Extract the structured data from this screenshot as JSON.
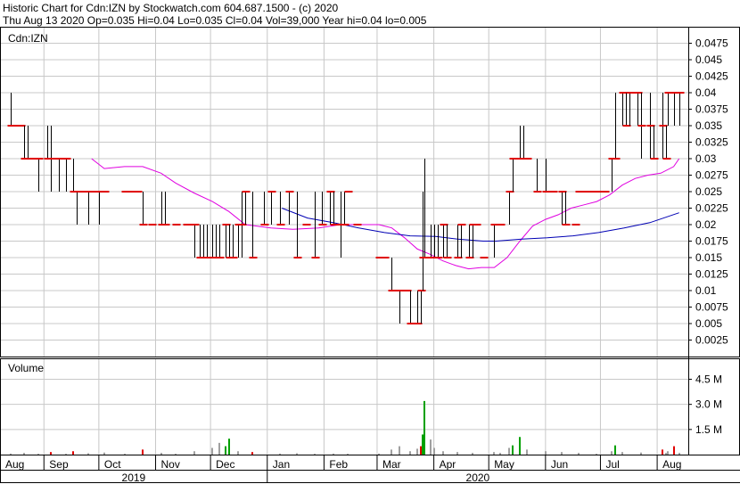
{
  "header": {
    "line1": "Historic Chart for Cdn:IZN by Stockwatch.com 604.687.1500 - (c) 2020",
    "line2": "Thu Aug 13 2020  Op=0.035  Hi=0.04  Lo=0.035  Cl=0.04  Vol=39,000  Year hi=0.04  lo=0.005"
  },
  "colors": {
    "background": "#ffffff",
    "grid": "#c8c8c8",
    "price_bar": "#000000",
    "close_tick": "#e00000",
    "ma_short": "#e000e0",
    "ma_long": "#0000b4",
    "vol_up": "#00a000",
    "vol_down": "#e00000",
    "vol_flat": "#a0a0a0"
  },
  "chart_data": [
    {
      "type": "ohlc",
      "title": "Cdn:IZN",
      "ylim": [
        0,
        0.05
      ],
      "y_ticks": [
        "0.0475",
        "0.045",
        "0.0425",
        "0.04",
        "0.0375",
        "0.035",
        "0.0325",
        "0.03",
        "0.0275",
        "0.025",
        "0.0225",
        "0.02",
        "0.0175",
        "0.015",
        "0.0125",
        "0.01",
        "0.0075",
        "0.005",
        "0.0025"
      ],
      "x_months": [
        "Aug",
        "Sep",
        "Oct",
        "Nov",
        "Dec",
        "Jan",
        "Feb",
        "Mar",
        "Apr",
        "May",
        "Jun",
        "Jul",
        "Aug"
      ],
      "x_years": [
        "2019",
        "2020"
      ],
      "grid": true,
      "bars": [
        [
          "2019-08-14",
          0.04,
          0.035,
          0.035
        ],
        [
          "2019-08-16",
          0.035,
          0.035,
          0.035
        ],
        [
          "2019-08-19",
          0.035,
          0.035,
          0.035
        ],
        [
          "2019-08-21",
          0.035,
          0.03,
          0.03
        ],
        [
          "2019-08-23",
          0.035,
          0.03,
          0.03
        ],
        [
          "2019-08-27",
          0.03,
          0.03,
          0.03
        ],
        [
          "2019-08-29",
          0.03,
          0.025,
          0.03
        ],
        [
          "2019-09-03",
          0.035,
          0.03,
          0.03
        ],
        [
          "2019-09-05",
          0.035,
          0.025,
          0.03
        ],
        [
          "2019-09-09",
          0.03,
          0.025,
          0.03
        ],
        [
          "2019-09-11",
          0.03,
          0.03,
          0.03
        ],
        [
          "2019-09-13",
          0.03,
          0.025,
          0.03
        ],
        [
          "2019-09-17",
          0.03,
          0.025,
          0.025
        ],
        [
          "2019-09-19",
          0.025,
          0.02,
          0.025
        ],
        [
          "2019-09-23",
          0.025,
          0.025,
          0.025
        ],
        [
          "2019-09-25",
          0.025,
          0.02,
          0.025
        ],
        [
          "2019-09-27",
          0.025,
          0.025,
          0.025
        ],
        [
          "2019-10-01",
          0.025,
          0.02,
          0.025
        ],
        [
          "2019-10-04",
          0.025,
          0.025,
          0.025
        ],
        [
          "2019-10-15",
          0.025,
          0.025,
          0.025
        ],
        [
          "2019-10-18",
          0.025,
          0.025,
          0.025
        ],
        [
          "2019-10-22",
          0.025,
          0.025,
          0.025
        ],
        [
          "2019-10-25",
          0.025,
          0.02,
          0.02
        ],
        [
          "2019-10-30",
          0.02,
          0.02,
          0.02
        ],
        [
          "2019-11-04",
          0.025,
          0.02,
          0.02
        ],
        [
          "2019-11-06",
          0.025,
          0.02,
          0.02
        ],
        [
          "2019-11-12",
          0.02,
          0.02,
          0.02
        ],
        [
          "2019-11-18",
          0.02,
          0.02,
          0.02
        ],
        [
          "2019-11-22",
          0.02,
          0.015,
          0.02
        ],
        [
          "2019-11-25",
          0.02,
          0.015,
          0.015
        ],
        [
          "2019-11-27",
          0.02,
          0.015,
          0.015
        ],
        [
          "2019-11-29",
          0.02,
          0.015,
          0.015
        ],
        [
          "2019-12-02",
          0.02,
          0.015,
          0.015
        ],
        [
          "2019-12-04",
          0.02,
          0.015,
          0.015
        ],
        [
          "2019-12-06",
          0.02,
          0.015,
          0.015
        ],
        [
          "2019-12-09",
          0.02,
          0.015,
          0.02
        ],
        [
          "2019-12-11",
          0.02,
          0.015,
          0.015
        ],
        [
          "2019-12-13",
          0.02,
          0.015,
          0.015
        ],
        [
          "2019-12-16",
          0.02,
          0.015,
          0.02
        ],
        [
          "2019-12-18",
          0.025,
          0.015,
          0.02
        ],
        [
          "2019-12-20",
          0.025,
          0.02,
          0.025
        ],
        [
          "2019-12-24",
          0.025,
          0.015,
          0.015
        ],
        [
          "2019-12-30",
          0.025,
          0.02,
          0.02
        ],
        [
          "2020-01-03",
          0.025,
          0.02,
          0.025
        ],
        [
          "2020-01-08",
          0.025,
          0.02,
          0.02
        ],
        [
          "2020-01-13",
          0.025,
          0.02,
          0.025
        ],
        [
          "2020-01-17",
          0.025,
          0.015,
          0.015
        ],
        [
          "2020-01-22",
          0.02,
          0.02,
          0.02
        ],
        [
          "2020-01-27",
          0.025,
          0.015,
          0.015
        ],
        [
          "2020-01-31",
          0.025,
          0.02,
          0.02
        ],
        [
          "2020-02-04",
          0.025,
          0.02,
          0.025
        ],
        [
          "2020-02-06",
          0.025,
          0.02,
          0.02
        ],
        [
          "2020-02-10",
          0.025,
          0.015,
          0.02
        ],
        [
          "2020-02-12",
          0.025,
          0.02,
          0.02
        ],
        [
          "2020-02-14",
          0.025,
          0.025,
          0.025
        ],
        [
          "2020-02-19",
          0.02,
          0.02,
          0.02
        ],
        [
          "2020-03-02",
          0.015,
          0.015,
          0.015
        ],
        [
          "2020-03-05",
          0.015,
          0.015,
          0.015
        ],
        [
          "2020-03-09",
          0.015,
          0.01,
          0.01
        ],
        [
          "2020-03-11",
          0.01,
          0.01,
          0.01
        ],
        [
          "2020-03-13",
          0.01,
          0.005,
          0.01
        ],
        [
          "2020-03-17",
          0.01,
          0.01,
          0.01
        ],
        [
          "2020-03-19",
          0.01,
          0.005,
          0.005
        ],
        [
          "2020-03-23",
          0.01,
          0.005,
          0.005
        ],
        [
          "2020-03-25",
          0.01,
          0.005,
          0.01
        ],
        [
          "2020-03-26",
          0.025,
          0.01,
          0.015
        ],
        [
          "2020-03-27",
          0.03,
          0.015,
          0.015
        ],
        [
          "2020-03-30",
          0.02,
          0.015,
          0.015
        ],
        [
          "2020-04-01",
          0.02,
          0.015,
          0.015
        ],
        [
          "2020-04-03",
          0.02,
          0.015,
          0.015
        ],
        [
          "2020-04-06",
          0.02,
          0.015,
          0.02
        ],
        [
          "2020-04-08",
          0.02,
          0.015,
          0.015
        ],
        [
          "2020-04-14",
          0.02,
          0.015,
          0.015
        ],
        [
          "2020-04-16",
          0.02,
          0.015,
          0.02
        ],
        [
          "2020-04-20",
          0.02,
          0.015,
          0.015
        ],
        [
          "2020-04-22",
          0.02,
          0.015,
          0.02
        ],
        [
          "2020-04-24",
          0.02,
          0.02,
          0.02
        ],
        [
          "2020-04-28",
          0.015,
          0.015,
          0.015
        ],
        [
          "2020-05-04",
          0.02,
          0.015,
          0.02
        ],
        [
          "2020-05-07",
          0.02,
          0.02,
          0.02
        ],
        [
          "2020-05-12",
          0.025,
          0.02,
          0.025
        ],
        [
          "2020-05-14",
          0.03,
          0.025,
          0.03
        ],
        [
          "2020-05-18",
          0.035,
          0.03,
          0.03
        ],
        [
          "2020-05-20",
          0.035,
          0.03,
          0.03
        ],
        [
          "2020-05-22",
          0.03,
          0.03,
          0.03
        ],
        [
          "2020-05-27",
          0.03,
          0.025,
          0.025
        ],
        [
          "2020-06-01",
          0.03,
          0.025,
          0.025
        ],
        [
          "2020-06-05",
          0.025,
          0.025,
          0.025
        ],
        [
          "2020-06-10",
          0.025,
          0.02,
          0.025
        ],
        [
          "2020-06-12",
          0.025,
          0.02,
          0.02
        ],
        [
          "2020-06-17",
          0.02,
          0.02,
          0.02
        ],
        [
          "2020-06-19",
          0.025,
          0.025,
          0.025
        ],
        [
          "2020-06-23",
          0.025,
          0.025,
          0.025
        ],
        [
          "2020-06-25",
          0.025,
          0.025,
          0.025
        ],
        [
          "2020-06-29",
          0.025,
          0.025,
          0.025
        ],
        [
          "2020-07-03",
          0.025,
          0.025,
          0.025
        ],
        [
          "2020-07-07",
          0.03,
          0.025,
          0.03
        ],
        [
          "2020-07-09",
          0.04,
          0.03,
          0.03
        ],
        [
          "2020-07-13",
          0.04,
          0.035,
          0.04
        ],
        [
          "2020-07-15",
          0.04,
          0.035,
          0.035
        ],
        [
          "2020-07-17",
          0.04,
          0.035,
          0.04
        ],
        [
          "2020-07-21",
          0.04,
          0.035,
          0.04
        ],
        [
          "2020-07-23",
          0.04,
          0.03,
          0.035
        ],
        [
          "2020-07-28",
          0.04,
          0.03,
          0.035
        ],
        [
          "2020-07-30",
          0.035,
          0.03,
          0.03
        ],
        [
          "2020-08-04",
          0.04,
          0.03,
          0.035
        ],
        [
          "2020-08-06",
          0.035,
          0.03,
          0.03
        ],
        [
          "2020-08-07",
          0.04,
          0.035,
          0.04
        ],
        [
          "2020-08-10",
          0.04,
          0.035,
          0.04
        ],
        [
          "2020-08-13",
          0.04,
          0.035,
          0.04
        ]
      ],
      "ma_short": [
        [
          "2019-09-27",
          0.03
        ],
        [
          "2019-10-04",
          0.0285
        ],
        [
          "2019-10-15",
          0.0288
        ],
        [
          "2019-10-25",
          0.0288
        ],
        [
          "2019-11-04",
          0.0278
        ],
        [
          "2019-11-12",
          0.0263
        ],
        [
          "2019-11-22",
          0.0248
        ],
        [
          "2019-12-02",
          0.0235
        ],
        [
          "2019-12-11",
          0.022
        ],
        [
          "2019-12-20",
          0.02
        ],
        [
          "2020-01-03",
          0.0195
        ],
        [
          "2020-01-15",
          0.0193
        ],
        [
          "2020-01-29",
          0.0195
        ],
        [
          "2020-02-10",
          0.02
        ],
        [
          "2020-02-21",
          0.02
        ],
        [
          "2020-03-02",
          0.02
        ],
        [
          "2020-03-09",
          0.0195
        ],
        [
          "2020-03-16",
          0.018
        ],
        [
          "2020-03-23",
          0.0163
        ],
        [
          "2020-03-30",
          0.0155
        ],
        [
          "2020-04-06",
          0.0145
        ],
        [
          "2020-04-13",
          0.0138
        ],
        [
          "2020-04-20",
          0.0133
        ],
        [
          "2020-04-27",
          0.0135
        ],
        [
          "2020-05-04",
          0.0135
        ],
        [
          "2020-05-11",
          0.015
        ],
        [
          "2020-05-18",
          0.0175
        ],
        [
          "2020-05-25",
          0.0198
        ],
        [
          "2020-06-01",
          0.0208
        ],
        [
          "2020-06-08",
          0.0215
        ],
        [
          "2020-06-15",
          0.0225
        ],
        [
          "2020-06-22",
          0.023
        ],
        [
          "2020-06-29",
          0.0235
        ],
        [
          "2020-07-06",
          0.0245
        ],
        [
          "2020-07-13",
          0.026
        ],
        [
          "2020-07-20",
          0.027
        ],
        [
          "2020-07-27",
          0.0275
        ],
        [
          "2020-08-03",
          0.0278
        ],
        [
          "2020-08-10",
          0.0288
        ],
        [
          "2020-08-13",
          0.03
        ]
      ],
      "ma_long": [
        [
          "2020-01-09",
          0.0225
        ],
        [
          "2020-01-23",
          0.021
        ],
        [
          "2020-02-06",
          0.0203
        ],
        [
          "2020-02-20",
          0.0195
        ],
        [
          "2020-03-05",
          0.0188
        ],
        [
          "2020-03-19",
          0.0183
        ],
        [
          "2020-04-02",
          0.0182
        ],
        [
          "2020-04-14",
          0.0178
        ],
        [
          "2020-04-28",
          0.0175
        ],
        [
          "2020-05-05",
          0.0175
        ],
        [
          "2020-05-19",
          0.0178
        ],
        [
          "2020-06-02",
          0.018
        ],
        [
          "2020-06-16",
          0.0183
        ],
        [
          "2020-06-30",
          0.0188
        ],
        [
          "2020-07-14",
          0.0195
        ],
        [
          "2020-07-28",
          0.0203
        ],
        [
          "2020-08-13",
          0.0218
        ]
      ]
    },
    {
      "type": "bar",
      "title": "Volume",
      "y_ticks": [
        "4.5 M",
        "3.0 M",
        "1.5 M"
      ],
      "ylim": [
        0,
        5.75
      ],
      "units": "M",
      "bars": [
        [
          "2019-08-14",
          0.06,
          "f"
        ],
        [
          "2019-08-21",
          0.1,
          "f"
        ],
        [
          "2019-08-29",
          0.05,
          "f"
        ],
        [
          "2019-09-05",
          0.15,
          "d"
        ],
        [
          "2019-09-13",
          0.05,
          "f"
        ],
        [
          "2019-09-17",
          0.2,
          "d"
        ],
        [
          "2019-09-25",
          0.08,
          "f"
        ],
        [
          "2019-10-04",
          0.12,
          "f"
        ],
        [
          "2019-10-15",
          0.05,
          "f"
        ],
        [
          "2019-10-25",
          0.3,
          "d"
        ],
        [
          "2019-11-04",
          0.1,
          "f"
        ],
        [
          "2019-11-12",
          0.05,
          "f"
        ],
        [
          "2019-11-22",
          0.2,
          "f"
        ],
        [
          "2019-12-02",
          0.4,
          "f"
        ],
        [
          "2019-12-06",
          0.7,
          "f"
        ],
        [
          "2019-12-09",
          0.5,
          "u"
        ],
        [
          "2019-12-11",
          0.95,
          "u"
        ],
        [
          "2019-12-16",
          0.2,
          "f"
        ],
        [
          "2019-12-24",
          0.15,
          "d"
        ],
        [
          "2020-01-08",
          0.06,
          "f"
        ],
        [
          "2020-01-17",
          0.08,
          "f"
        ],
        [
          "2020-01-27",
          0.05,
          "f"
        ],
        [
          "2020-02-06",
          0.06,
          "f"
        ],
        [
          "2020-02-14",
          0.05,
          "f"
        ],
        [
          "2020-03-02",
          0.06,
          "f"
        ],
        [
          "2020-03-09",
          0.3,
          "f"
        ],
        [
          "2020-03-13",
          0.5,
          "f"
        ],
        [
          "2020-03-19",
          0.2,
          "f"
        ],
        [
          "2020-03-23",
          0.35,
          "f"
        ],
        [
          "2020-03-25",
          0.5,
          "d"
        ],
        [
          "2020-03-26",
          1.2,
          "u"
        ],
        [
          "2020-03-27",
          3.2,
          "u"
        ],
        [
          "2020-03-30",
          0.9,
          "f"
        ],
        [
          "2020-04-01",
          0.4,
          "f"
        ],
        [
          "2020-04-06",
          0.2,
          "f"
        ],
        [
          "2020-04-14",
          0.15,
          "f"
        ],
        [
          "2020-04-22",
          0.1,
          "f"
        ],
        [
          "2020-05-04",
          0.15,
          "f"
        ],
        [
          "2020-05-07",
          0.1,
          "f"
        ],
        [
          "2020-05-12",
          0.4,
          "f"
        ],
        [
          "2020-05-14",
          0.55,
          "u"
        ],
        [
          "2020-05-18",
          1.05,
          "u"
        ],
        [
          "2020-05-22",
          0.3,
          "f"
        ],
        [
          "2020-06-01",
          0.2,
          "f"
        ],
        [
          "2020-06-10",
          0.15,
          "f"
        ],
        [
          "2020-06-19",
          0.1,
          "f"
        ],
        [
          "2020-06-29",
          0.05,
          "f"
        ],
        [
          "2020-07-07",
          0.2,
          "f"
        ],
        [
          "2020-07-09",
          0.55,
          "u"
        ],
        [
          "2020-07-13",
          0.15,
          "f"
        ],
        [
          "2020-07-23",
          0.12,
          "f"
        ],
        [
          "2020-08-04",
          0.3,
          "d"
        ],
        [
          "2020-08-06",
          0.1,
          "f"
        ],
        [
          "2020-08-07",
          0.2,
          "f"
        ],
        [
          "2020-08-10",
          0.5,
          "d"
        ],
        [
          "2020-08-13",
          0.1,
          "f"
        ]
      ]
    }
  ]
}
